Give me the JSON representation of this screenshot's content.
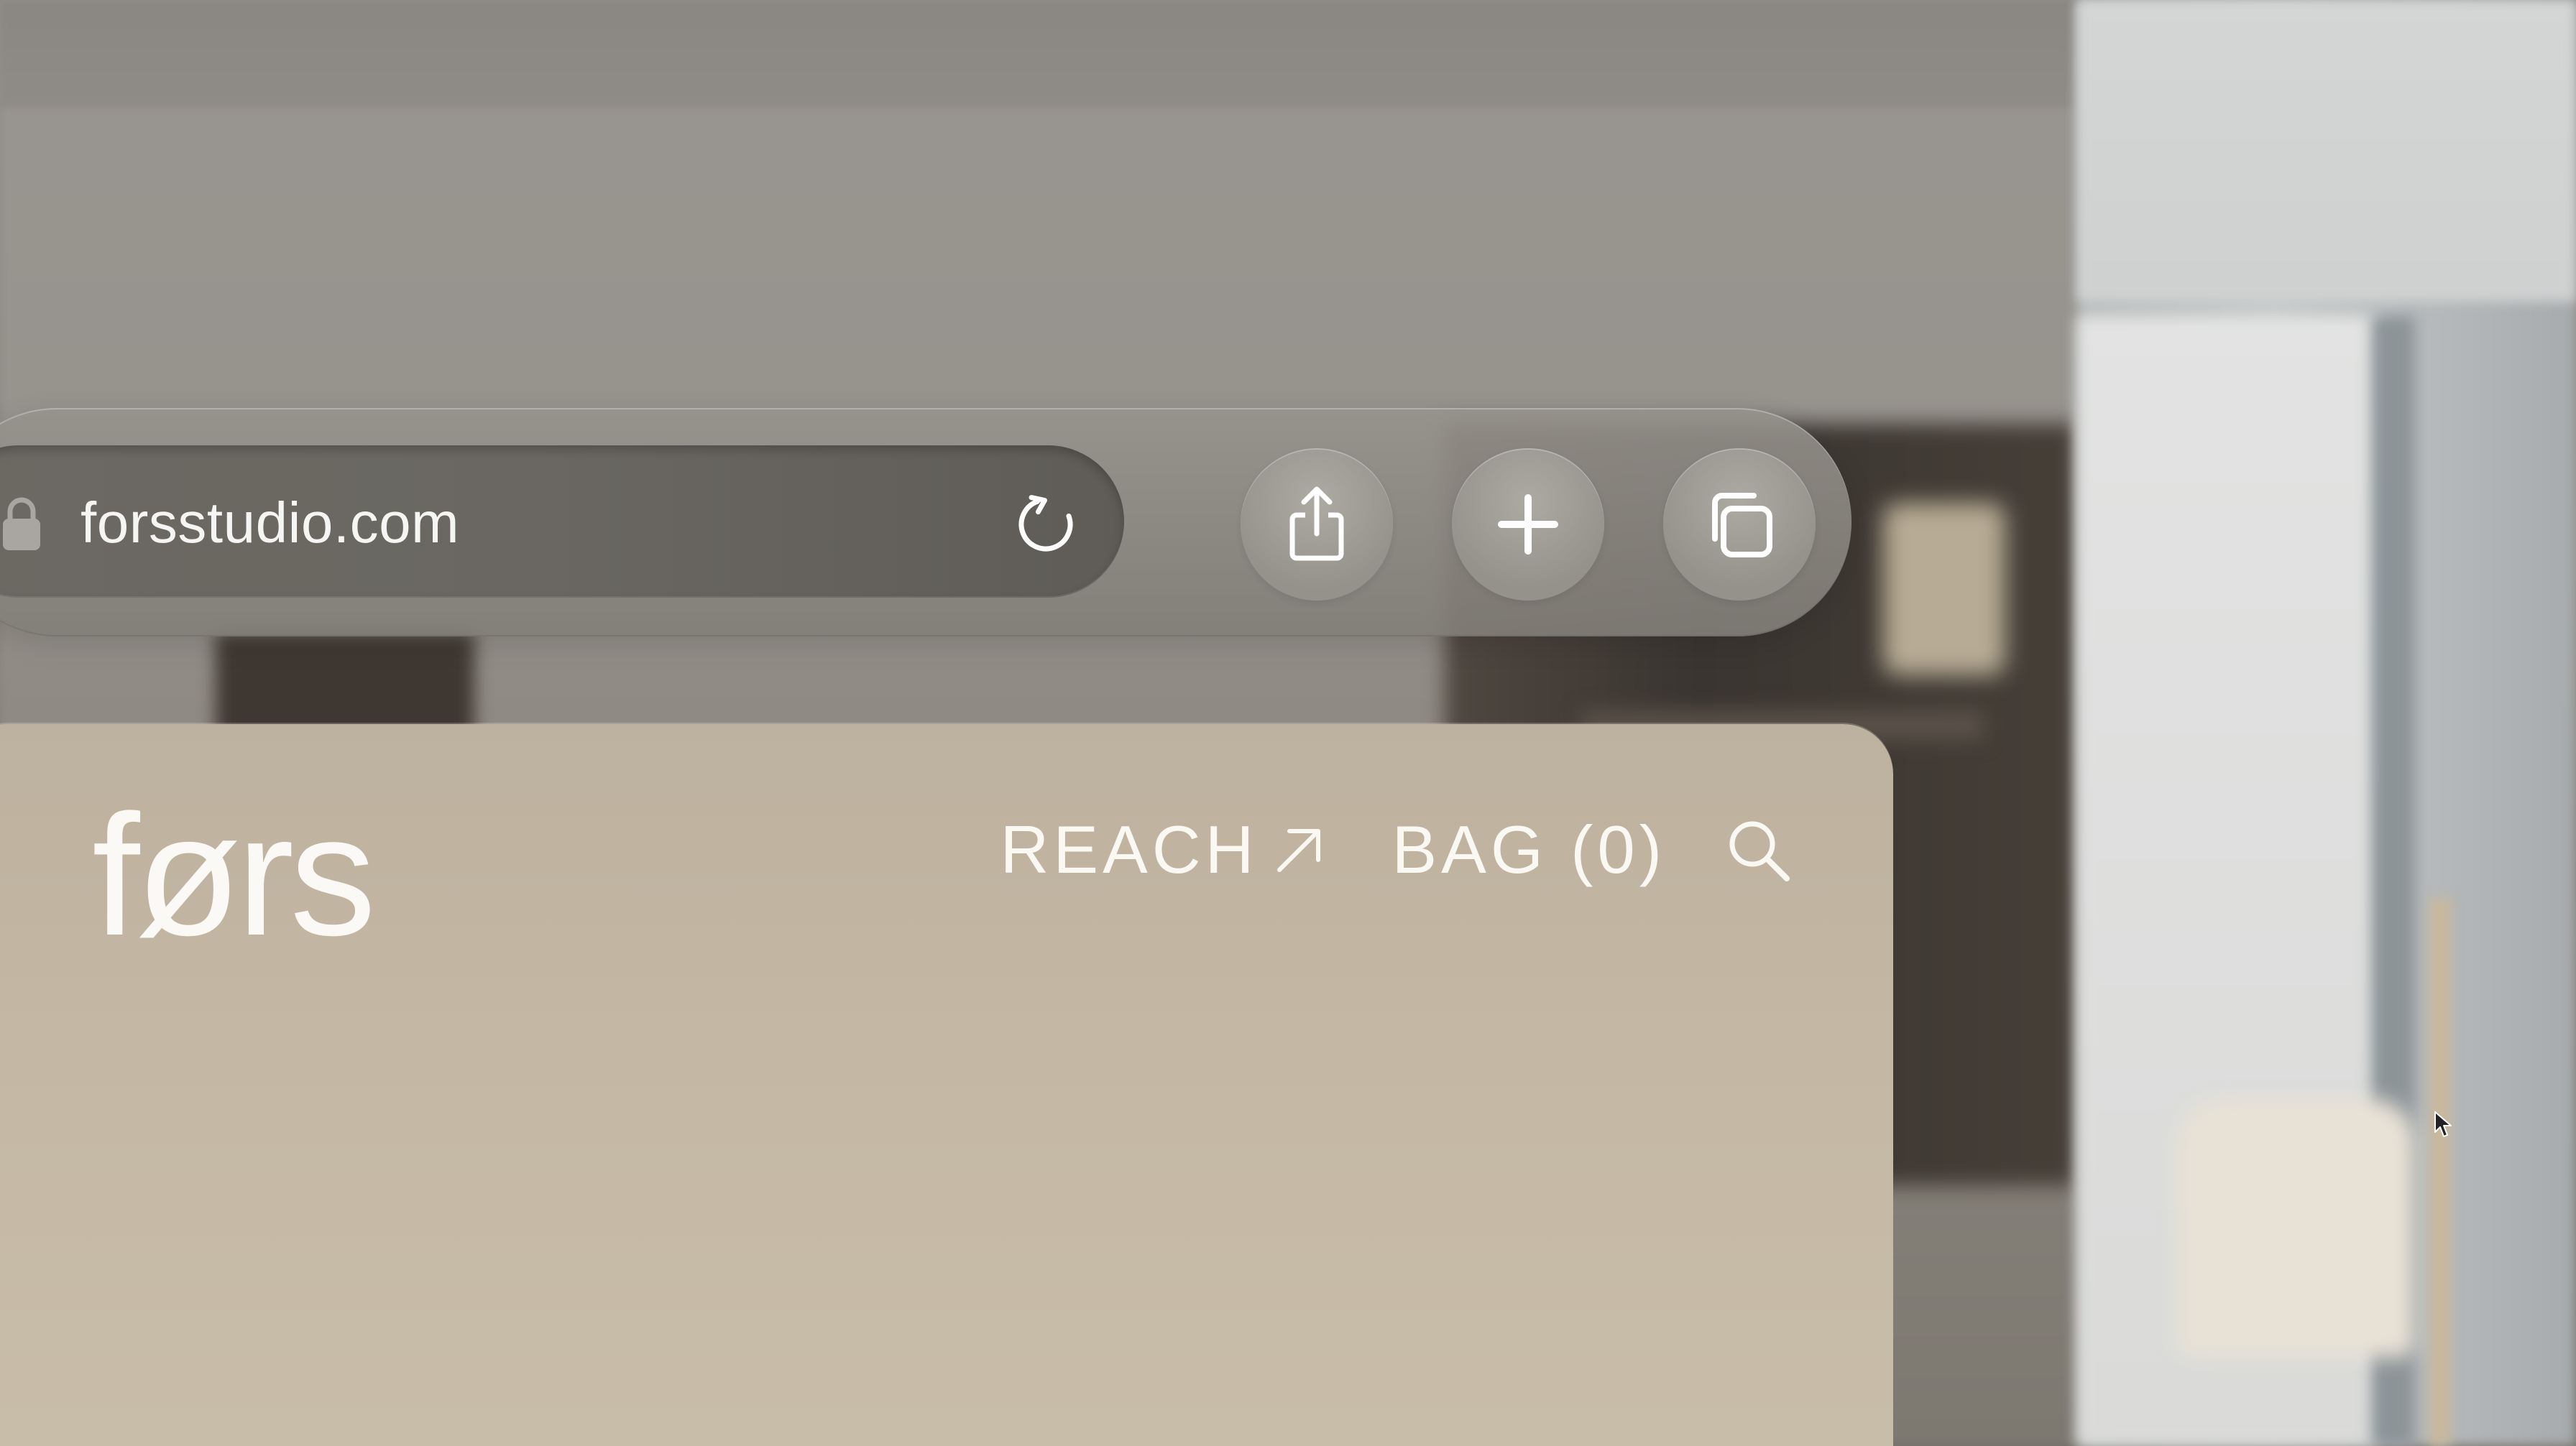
{
  "browser": {
    "url": "forsstudio.com",
    "buttons": {
      "reload": "reload-icon",
      "share": "share-icon",
      "new_tab": "plus-icon",
      "tabs": "tabs-icon"
    }
  },
  "site": {
    "logo": "førs",
    "nav": {
      "reach_label": "REACH",
      "bag_label": "BAG (0)"
    }
  },
  "colors": {
    "page_background": "#c4b8a4",
    "toolbar_glass": "#8e8a84",
    "text": "#faf8f3"
  }
}
